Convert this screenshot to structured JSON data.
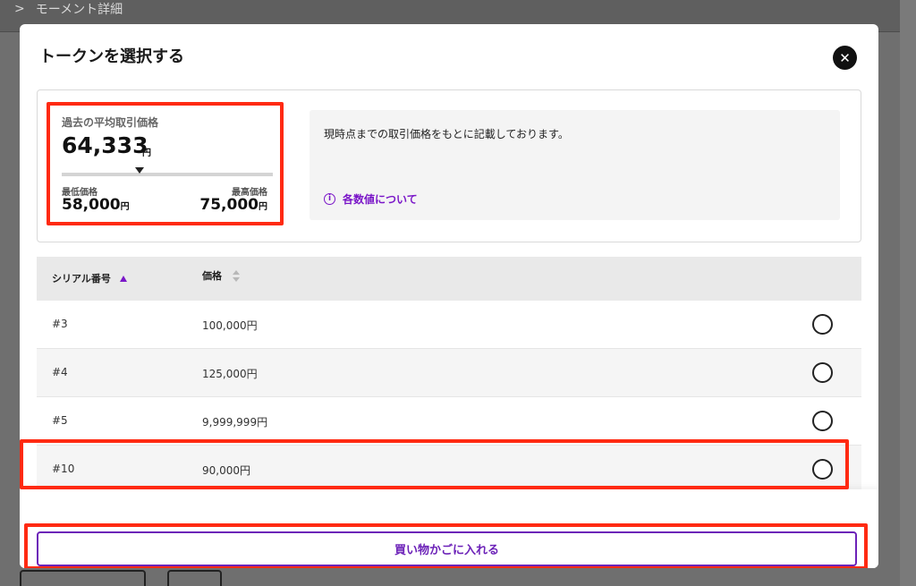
{
  "background": {
    "breadcrumb_arrow": ">",
    "breadcrumb_title": "モーメント詳細"
  },
  "modal": {
    "title": "トークンを選択する",
    "close_glyph": "✕"
  },
  "price_summary": {
    "avg_label": "過去の平均取引価格",
    "avg_value": "64,333",
    "avg_unit": "円",
    "min_label": "最低価格",
    "min_value": "58,000",
    "max_label": "最高価格",
    "max_value": "75,000",
    "unit": "円",
    "avg_position_fraction": 0.37
  },
  "note": {
    "text": "現時点までの取引価格をもとに記載しております。",
    "link_label": "各数値について",
    "link_icon": "info-icon",
    "info_glyph": "i"
  },
  "table": {
    "headers": {
      "serial": "シリアル番号",
      "price": "価格"
    },
    "rows": [
      {
        "serial": "#3",
        "price": "100,000円"
      },
      {
        "serial": "#4",
        "price": "125,000円"
      },
      {
        "serial": "#5",
        "price": "9,999,999円"
      },
      {
        "serial": "#10",
        "price": "90,000円"
      }
    ]
  },
  "footer": {
    "cart_button_label": "買い物かごに入れる"
  },
  "colors": {
    "accent_purple": "#7a16c8",
    "highlight_red": "#ff2a12"
  }
}
